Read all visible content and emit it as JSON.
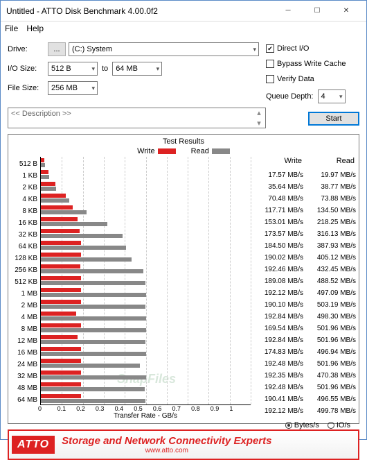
{
  "window": {
    "title": "Untitled - ATTO Disk Benchmark 4.00.0f2"
  },
  "menu": {
    "file": "File",
    "help": "Help"
  },
  "labels": {
    "drive": "Drive:",
    "iosize": "I/O Size:",
    "filesize": "File Size:",
    "to": "to",
    "qdepth": "Queue Depth:"
  },
  "fields": {
    "drive_btn": "...",
    "drive": "(C:) System",
    "io_from": "512 B",
    "io_to": "64 MB",
    "filesize": "256 MB",
    "qdepth": "4"
  },
  "checks": {
    "direct_io": {
      "label": "Direct I/O",
      "checked": true
    },
    "bypass": {
      "label": "Bypass Write Cache",
      "checked": false
    },
    "verify": {
      "label": "Verify Data",
      "checked": false
    }
  },
  "buttons": {
    "start": "Start"
  },
  "description": {
    "placeholder": "<< Description >>"
  },
  "results": {
    "title": "Test Results",
    "legend_write": "Write",
    "legend_read": "Read",
    "col_write": "Write",
    "col_read": "Read",
    "xlabel": "Transfer Rate - GB/s",
    "units": {
      "bytes": "Bytes/s",
      "io": "IO/s",
      "selected": "bytes"
    }
  },
  "xticks": [
    "0",
    "0.1",
    "0.2",
    "0.3",
    "0.4",
    "0.5",
    "0.6",
    "0.7",
    "0.8",
    "0.9",
    "1"
  ],
  "chart_data": {
    "type": "bar",
    "title": "Test Results",
    "xlabel": "Transfer Rate - GB/s",
    "ylim": [
      0,
      1
    ],
    "series_names": [
      "Write",
      "Read"
    ],
    "unit": "MB/s",
    "rows": [
      {
        "label": "512 B",
        "write": 17.57,
        "read": 19.97
      },
      {
        "label": "1 KB",
        "write": 35.64,
        "read": 38.77
      },
      {
        "label": "2 KB",
        "write": 70.48,
        "read": 73.88
      },
      {
        "label": "4 KB",
        "write": 117.71,
        "read": 134.5
      },
      {
        "label": "8 KB",
        "write": 153.01,
        "read": 218.25
      },
      {
        "label": "16 KB",
        "write": 173.57,
        "read": 316.13
      },
      {
        "label": "32 KB",
        "write": 184.5,
        "read": 387.93
      },
      {
        "label": "64 KB",
        "write": 190.02,
        "read": 405.12
      },
      {
        "label": "128 KB",
        "write": 192.46,
        "read": 432.45
      },
      {
        "label": "256 KB",
        "write": 189.08,
        "read": 488.52
      },
      {
        "label": "512 KB",
        "write": 192.12,
        "read": 497.09
      },
      {
        "label": "1 MB",
        "write": 190.1,
        "read": 503.19
      },
      {
        "label": "2 MB",
        "write": 192.84,
        "read": 498.3
      },
      {
        "label": "4 MB",
        "write": 169.54,
        "read": 501.96
      },
      {
        "label": "8 MB",
        "write": 192.84,
        "read": 501.96
      },
      {
        "label": "12 MB",
        "write": 174.83,
        "read": 496.94
      },
      {
        "label": "16 MB",
        "write": 192.48,
        "read": 501.96
      },
      {
        "label": "24 MB",
        "write": 192.35,
        "read": 470.38
      },
      {
        "label": "32 MB",
        "write": 192.48,
        "read": 501.96
      },
      {
        "label": "48 MB",
        "write": 190.41,
        "read": 496.55
      },
      {
        "label": "64 MB",
        "write": 192.12,
        "read": 499.78
      }
    ]
  },
  "footer": {
    "logo": "ATTO",
    "line1": "Storage and Network Connectivity Experts",
    "line2": "www.atto.com"
  },
  "watermark": "SnapFiles"
}
